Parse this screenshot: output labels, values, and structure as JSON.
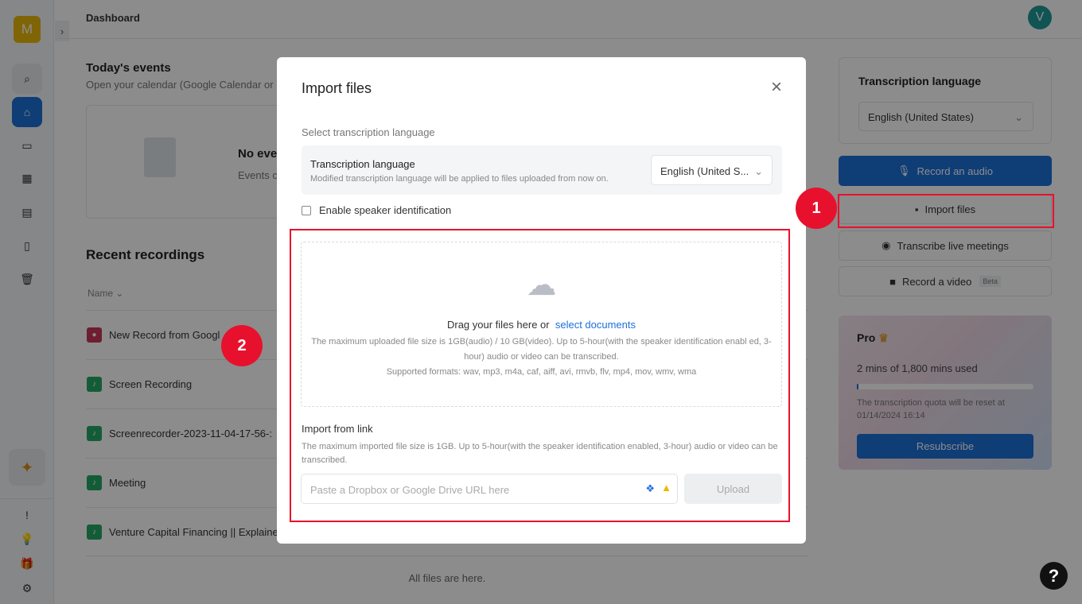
{
  "sidebar": {
    "logo": "M",
    "expand": "›"
  },
  "header": {
    "title": "Dashboard",
    "avatar": "V"
  },
  "events": {
    "title": "Today's events",
    "subtitle": "Open your calendar (Google Calendar or",
    "empty_title": "No eve",
    "empty_sub": "Events c"
  },
  "recent": {
    "title": "Recent recordings",
    "name_col": "Name",
    "footer": "All files are here.",
    "items": [
      {
        "name": "New Record from Googl",
        "type": "meeting"
      },
      {
        "name": "Screen Recording",
        "type": "audio"
      },
      {
        "name": "Screenrecorder-2023-11-04-17-56-:",
        "type": "audio"
      },
      {
        "name": "Meeting",
        "type": "audio"
      },
      {
        "name": "Venture Capital Financing || Explaine",
        "type": "audio"
      }
    ]
  },
  "right": {
    "lang_title": "Transcription language",
    "lang_value": "English (United States)",
    "record_audio": "Record an audio",
    "import_files": "Import files",
    "live_meetings": "Transcribe live meetings",
    "record_video": "Record a video",
    "beta": "Beta",
    "pro": {
      "title": "Pro",
      "usage": "2 mins of 1,800 mins used",
      "used_fraction": 0.0011,
      "reset": "The transcription quota will be reset at 01/14/2024 16:14",
      "resubscribe": "Resubscribe"
    }
  },
  "modal": {
    "title": "Import files",
    "close": "×",
    "section": "Select transcription language",
    "lang_label": "Transcription language",
    "lang_hint": "Modified transcription language will be applied to files uploaded from now on.",
    "lang_value": "English (United S...",
    "speaker": "Enable speaker identification",
    "speaker_checked": false,
    "drag": "Drag your files here or",
    "select": "select documents",
    "limit": "The maximum uploaded file size is 1GB(audio) / 10 GB(video). Up to 5-hour(with the speaker identification enabl ed, 3-hour) audio or video can be transcribed.",
    "formats": "Supported formats: wav, mp3, m4a, caf, aiff, avi, rmvb, flv, mp4, mov, wmv, wma",
    "link_title": "Import from link",
    "link_hint": "The maximum imported file size is 1GB. Up to 5-hour(with the speaker identification enabled, 3-hour) audio or video can be transcribed.",
    "link_placeholder": "Paste a Dropbox or Google Drive URL here",
    "upload": "Upload"
  },
  "annotations": [
    "1",
    "2"
  ],
  "help": "?",
  "colors": {
    "primary": "#1d6fd8",
    "annotation": "#e8112d",
    "accent_logo": "#e9b90b"
  }
}
